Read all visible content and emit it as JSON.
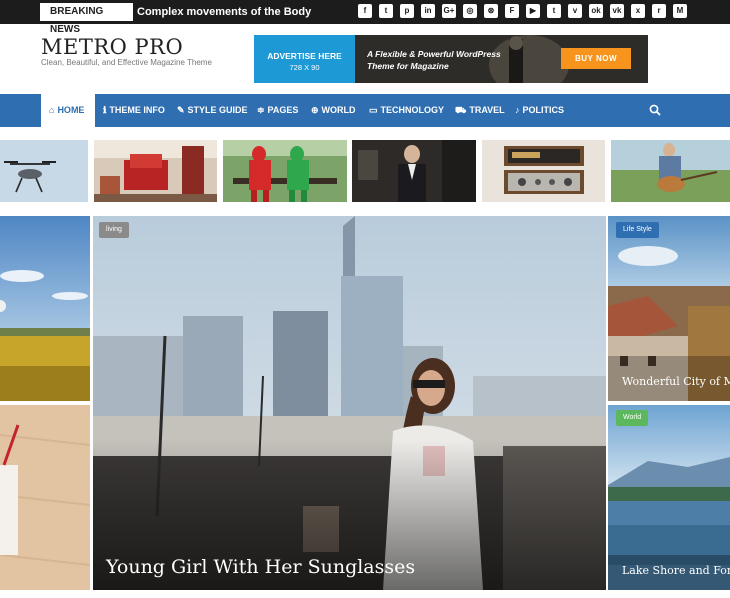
{
  "topbar": {
    "breaking_label": "BREAKING NEWS",
    "breaking_text": "Complex movements of the Body",
    "socials": [
      {
        "icon": "facebook-icon",
        "glyph": "f"
      },
      {
        "icon": "twitter-icon",
        "glyph": "t"
      },
      {
        "icon": "pinterest-icon",
        "glyph": "p"
      },
      {
        "icon": "linkedin-icon",
        "glyph": "in"
      },
      {
        "icon": "google-plus-icon",
        "glyph": "G+"
      },
      {
        "icon": "instagram-icon",
        "glyph": "◎"
      },
      {
        "icon": "dribbble-icon",
        "glyph": "⊛"
      },
      {
        "icon": "flickr-icon",
        "glyph": "F"
      },
      {
        "icon": "youtube-icon",
        "glyph": "▶"
      },
      {
        "icon": "tumblr-icon",
        "glyph": "t"
      },
      {
        "icon": "vimeo-icon",
        "glyph": "v"
      },
      {
        "icon": "odnoklassniki-icon",
        "glyph": "ok"
      },
      {
        "icon": "vk-icon",
        "glyph": "vk"
      },
      {
        "icon": "xing-icon",
        "glyph": "x"
      },
      {
        "icon": "reddit-icon",
        "glyph": "r"
      },
      {
        "icon": "medium-icon",
        "glyph": "M"
      }
    ]
  },
  "header": {
    "title": "METRO PRO",
    "tagline": "Clean, Beautiful, and Effective Magazine Theme",
    "ad": {
      "label": "ADVERTISE HERE",
      "size": "728 X 90",
      "line1": "A Flexible & Powerful WordPress",
      "line2": "Theme for Magazine",
      "button": "BUY NOW"
    }
  },
  "nav": {
    "items": [
      {
        "label": "HOME",
        "icon": "home-icon",
        "active": true
      },
      {
        "label": "THEME INFO",
        "icon": "info-icon"
      },
      {
        "label": "STYLE GUIDE",
        "icon": "paint-icon"
      },
      {
        "label": "PAGES",
        "icon": "pages-icon"
      },
      {
        "label": "WORLD",
        "icon": "globe-icon"
      },
      {
        "label": "TECHNOLOGY",
        "icon": "monitor-icon"
      },
      {
        "label": "TRAVEL",
        "icon": "car-icon"
      },
      {
        "label": "POLITICS",
        "icon": "microphone-icon"
      }
    ],
    "search_icon": "search-icon"
  },
  "thumbs": [
    "drone",
    "red chair",
    "green and red costumes on bench",
    "man in suit",
    "stereo receiver",
    "man playing guitar"
  ],
  "grid": {
    "center": {
      "badge": "living",
      "title": "Young Girl With Her Sunglasses"
    },
    "right_top": {
      "badge": "Life Style",
      "title": "Wonderful City of Mikon"
    },
    "right_bottom": {
      "badge": "World",
      "title": "Lake Shore and Forest"
    }
  },
  "colors": {
    "nav": "#2f6eb1",
    "ad_blue": "#1d99d6",
    "ad_button": "#f7941d",
    "badge_living": "#8a8a8a",
    "badge_lifestyle": "#2f6eb1",
    "badge_world": "#5cb85c"
  }
}
